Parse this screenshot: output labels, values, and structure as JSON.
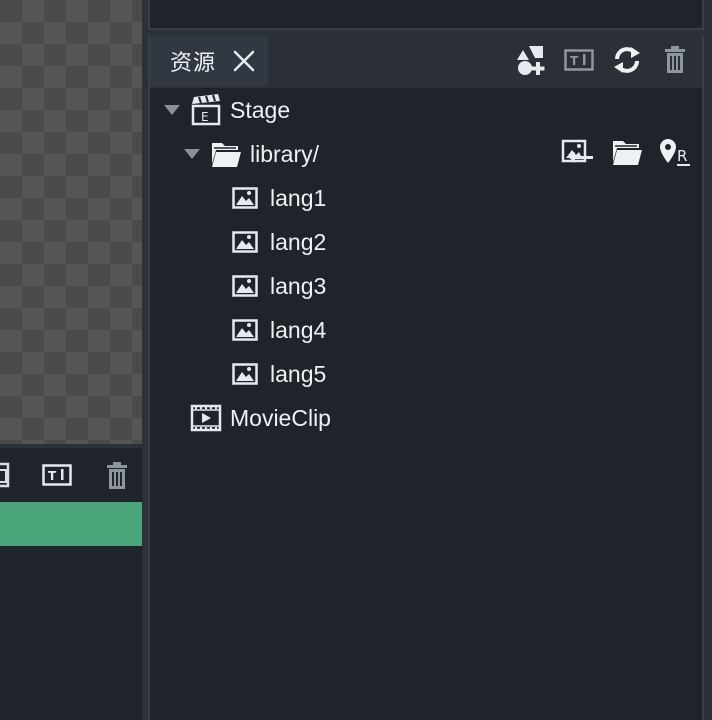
{
  "panel": {
    "tab_title": "资源",
    "header_buttons": [
      {
        "name": "create-asset-button",
        "icon": "shapes-add-icon"
      },
      {
        "name": "rename-button",
        "icon": "text-field-icon"
      },
      {
        "name": "refresh-button",
        "icon": "refresh-icon"
      },
      {
        "name": "delete-button",
        "icon": "trash-icon"
      }
    ]
  },
  "tree": {
    "stage": {
      "label": "Stage",
      "icon": "clapperboard-icon",
      "expanded": true
    },
    "library": {
      "label": "library/",
      "icon": "folder-open-icon",
      "expanded": true,
      "actions": [
        {
          "name": "import-image-button",
          "icon": "image-import-icon"
        },
        {
          "name": "open-folder-button",
          "icon": "folder-open-icon"
        },
        {
          "name": "locate-button",
          "icon": "map-pin-r-icon"
        }
      ],
      "items": [
        {
          "label": "lang1",
          "icon": "image-icon"
        },
        {
          "label": "lang2",
          "icon": "image-icon"
        },
        {
          "label": "lang3",
          "icon": "image-icon"
        },
        {
          "label": "lang4",
          "icon": "image-icon"
        },
        {
          "label": "lang5",
          "icon": "image-icon"
        }
      ]
    },
    "movieclip": {
      "label": "MovieClip",
      "icon": "film-icon"
    }
  },
  "left_panel": {
    "toolbar_icons": [
      "copy-icon",
      "text-field-icon",
      "trash-icon"
    ],
    "selection_color": "#4aa57a"
  },
  "colors": {
    "background": "#1f232a",
    "header": "#2b3038",
    "tab": "#313842",
    "text": "#eef1f4"
  }
}
